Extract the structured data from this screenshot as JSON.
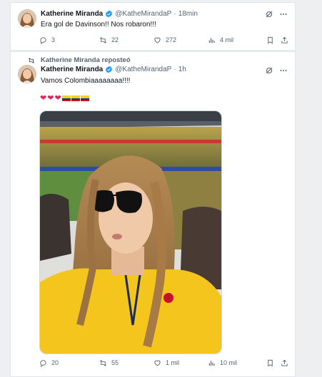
{
  "tweet1": {
    "name": "Katherine Miranda",
    "handle": "@KatheMirandaP",
    "time": "18min",
    "text": "Era gol de Davinson!! Nos robaron!!!",
    "replies": "3",
    "reposts": "22",
    "likes": "272",
    "views": "4 mil"
  },
  "tweet2": {
    "repost_label": "Katherine Miranda reposteó",
    "name": "Katherine Miranda",
    "handle": "@KatheMirandaP",
    "time": "1h",
    "text": "Vamos Colombiaaaaaaaa!!!!",
    "emoji": {
      "hearts": 3,
      "flags": 3
    },
    "replies": "20",
    "reposts": "55",
    "likes": "1 mil",
    "views": "10 mil"
  },
  "colors": {
    "verified": "#1d9bf0",
    "text_muted": "#536471",
    "heart": "#e0245e",
    "flag_yellow": "#fcd116",
    "flag_blue": "#003893",
    "flag_red": "#ce1126",
    "jersey": "#f4c51c"
  },
  "icons": [
    "verified-badge-icon",
    "grok-icon",
    "more-icon",
    "reply-icon",
    "repost-icon",
    "like-icon",
    "views-icon",
    "bookmark-icon",
    "share-icon"
  ]
}
